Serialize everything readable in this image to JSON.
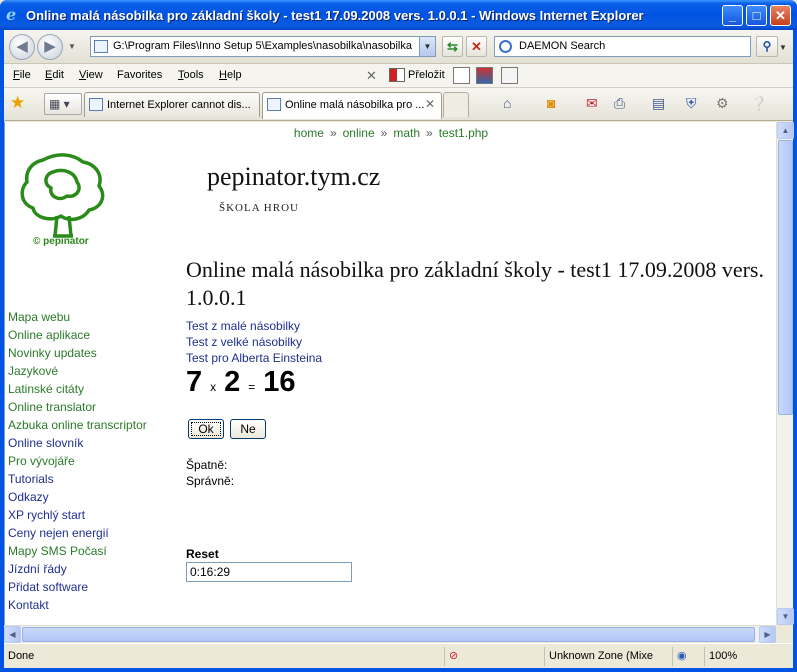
{
  "window": {
    "title": "Online malá násobilka pro základní školy - test1 17.09.2008 vers. 1.0.0.1 - Windows Internet Explorer",
    "min_label": "_",
    "max_label": "□",
    "close_label": "✕"
  },
  "toolbar": {
    "back_glyph": "◀",
    "forward_glyph": "▶",
    "address": "G:\\Program Files\\Inno Setup 5\\Examples\\nasobilka\\nasobilka.h",
    "search_placeholder": "DAEMON Search"
  },
  "menu": {
    "items": [
      {
        "hot": "F",
        "rest": "ile"
      },
      {
        "hot": "E",
        "rest": "dit"
      },
      {
        "hot": "V",
        "rest": "iew"
      },
      {
        "hot": "",
        "rest": "Favorites"
      },
      {
        "hot": "T",
        "rest": "ools"
      },
      {
        "hot": "H",
        "rest": "elp"
      }
    ],
    "translate_label": "Přeložit"
  },
  "tabs": [
    {
      "label": "Internet Explorer cannot dis..."
    },
    {
      "label": "Online malá násobilka pro ..."
    }
  ],
  "breadcrumb": [
    "home",
    "online",
    "math",
    "test1.php"
  ],
  "logo": {
    "caption": "© pepinator"
  },
  "site": {
    "title": "pepinator.tym.cz",
    "subtitle": "ŠKOLA HROU"
  },
  "page": {
    "heading": "Online malá násobilka pro základní školy - test1 17.09.2008 vers. 1.0.0.1"
  },
  "sidebar": [
    {
      "label": "Mapa webu",
      "color": "#2a7a2a"
    },
    {
      "label": "Online aplikace",
      "color": "#2a7a2a"
    },
    {
      "label": "Novinky updates",
      "color": "#2a7a2a"
    },
    {
      "label": "Jazykové",
      "color": "#2a7a2a"
    },
    {
      "label": "Latinské citáty",
      "color": "#2a7a2a"
    },
    {
      "label": "Online translator",
      "color": "#2a7a2a"
    },
    {
      "label": "Azbuka online transcriptor",
      "color": "#2a7a2a"
    },
    {
      "label": "Online slovník",
      "color": "#1f2f8f"
    },
    {
      "label": "Pro vývojáře",
      "color": "#2a7a2a"
    },
    {
      "label": "Tutorials",
      "color": "#1f2f8f"
    },
    {
      "label": "Odkazy",
      "color": "#1f2f8f"
    },
    {
      "label": "XP rychlý start",
      "color": "#1f2f8f"
    },
    {
      "label": "Ceny nejen energií",
      "color": "#1f2f8f"
    },
    {
      "label": "Mapy SMS Počasí",
      "color": "#2a7a2a"
    },
    {
      "label": "Jízdní řády",
      "color": "#1f2f8f"
    },
    {
      "label": "Přidat software",
      "color": "#1f2f8f"
    },
    {
      "label": "Kontakt",
      "color": "#1f2f8f"
    }
  ],
  "tests": [
    {
      "label": "Test z malé násobilky"
    },
    {
      "label": "Test z velké násobilky"
    },
    {
      "label": "Test pro Alberta Einsteina"
    }
  ],
  "problem": {
    "a": "7",
    "op": "x",
    "b": "2",
    "eq": "=",
    "answer": "16"
  },
  "buttons": {
    "ok": "Ok",
    "ne": "Ne"
  },
  "stats": {
    "wrong_label": "Špatně:",
    "correct_label": "Správně:"
  },
  "reset": {
    "label": "Reset",
    "timer": "0:16:29"
  },
  "status": {
    "text": "Done",
    "zone": "Unknown Zone (Mixe",
    "zoom": "100%"
  }
}
